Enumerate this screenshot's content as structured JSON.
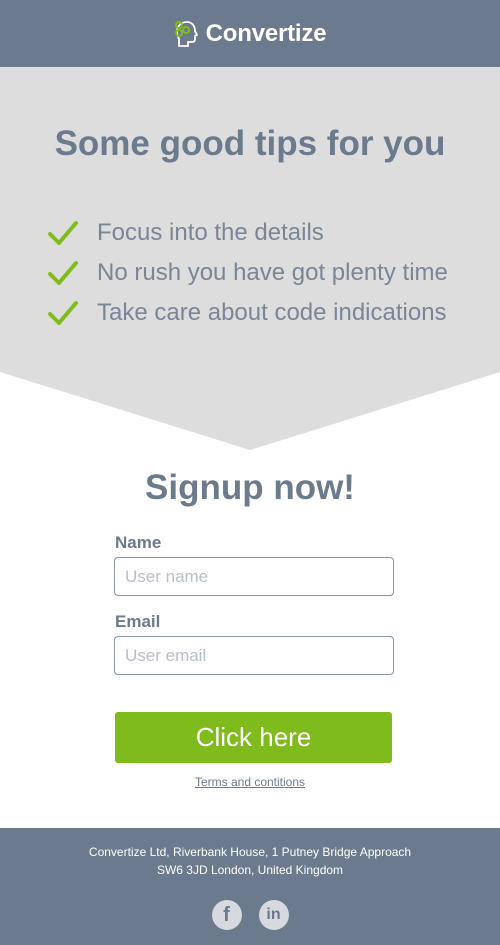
{
  "header": {
    "brand": "Convertize",
    "logo_icon": "convertize-head-icon"
  },
  "tips": {
    "title": "Some good tips for you",
    "items": [
      {
        "text": "Focus into the details",
        "icon": "check-icon"
      },
      {
        "text": "No rush you have got plenty time",
        "icon": "check-icon"
      },
      {
        "text": "Take care about code indications",
        "icon": "check-icon"
      }
    ]
  },
  "signup": {
    "title": "Signup now!",
    "name_label": "Name",
    "name_placeholder": "User name",
    "name_value": "",
    "email_label": "Email",
    "email_placeholder": "User email",
    "email_value": "",
    "button_label": "Click here",
    "terms_link": "Terms and contitions"
  },
  "footer": {
    "address_line1": "Convertize Ltd, Riverbank House, 1 Putney Bridge Approach",
    "address_line2": "SW6 3JD London, United Kingdom",
    "social": [
      {
        "name": "facebook-icon",
        "glyph": "f"
      },
      {
        "name": "linkedin-icon",
        "glyph": "in"
      }
    ]
  },
  "colors": {
    "brand_slate": "#6b7a8c",
    "accent_green": "#80bb1e",
    "panel_gray": "#dddddd"
  }
}
